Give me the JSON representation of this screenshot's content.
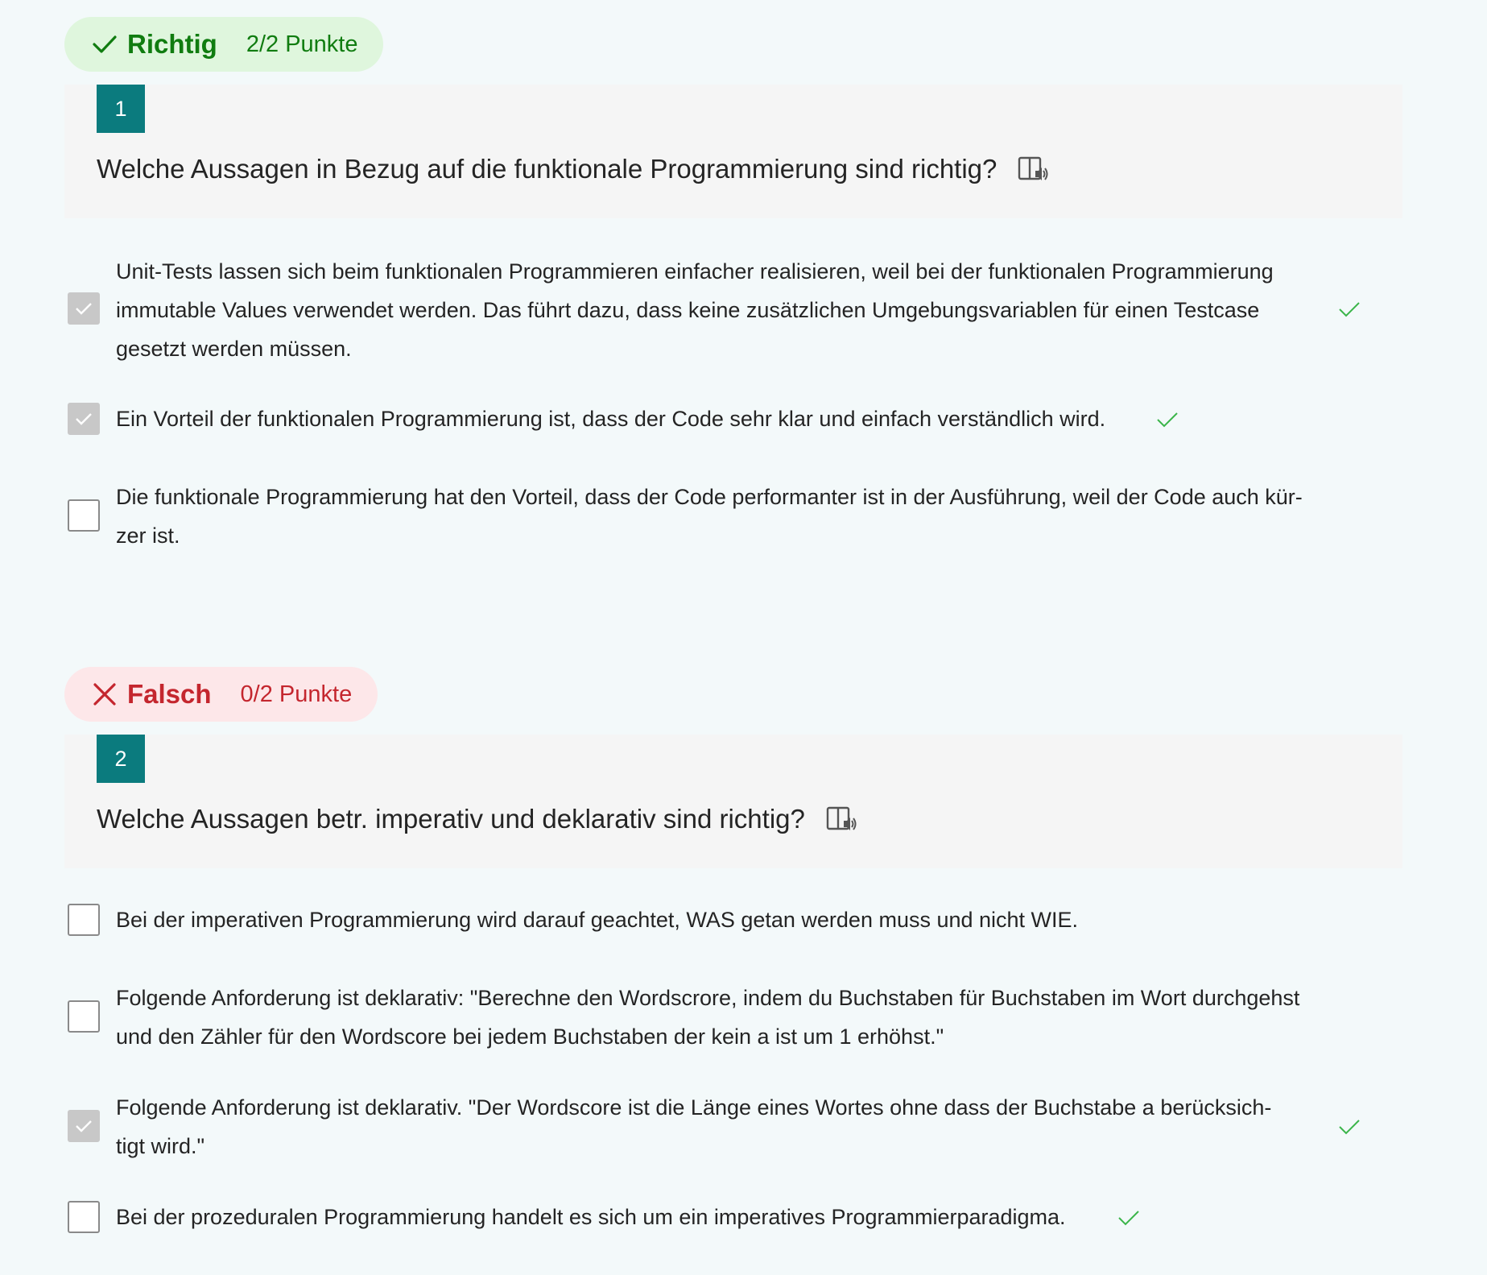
{
  "colors": {
    "correct_green": "#107c10",
    "wrong_red": "#c4262e",
    "question_number_bg": "#0b7b7e",
    "checkmark_green": "#3bb54a"
  },
  "questions": [
    {
      "result": {
        "status": "Richtig",
        "points": "2/2 Punkte",
        "icon": "checkmark-icon"
      },
      "number": "1",
      "title": "Welche Aussagen in Bezug auf die funktionale Programmierung sind richtig?",
      "reader_icon": "immersive-reader-icon",
      "options": [
        {
          "lines": [
            "Unit-Tests lassen sich beim funktionalen Programmieren einfacher realisieren, weil bei der funktionalen Programmierung",
            "immutable Values verwendet werden. Das führt dazu, dass keine zusätzlichen Umgebungsvariablen für einen Testcase",
            "gesetzt werden müssen."
          ],
          "checked": true,
          "correct_mark": true
        },
        {
          "lines": [
            "Ein Vorteil der funktionalen Programmierung ist, dass der Code sehr klar und einfach verständlich wird."
          ],
          "checked": true,
          "correct_mark": true
        },
        {
          "lines": [
            "Die funktionale Programmierung hat den Vorteil, dass der Code performanter ist in der Ausführung, weil der Code auch kür-",
            "zer ist."
          ],
          "checked": false,
          "correct_mark": false
        }
      ]
    },
    {
      "result": {
        "status": "Falsch",
        "points": "0/2 Punkte",
        "icon": "cross-icon"
      },
      "number": "2",
      "title": "Welche Aussagen betr. imperativ und deklarativ sind richtig?",
      "reader_icon": "immersive-reader-icon",
      "options": [
        {
          "lines": [
            "Bei der imperativen Programmierung wird darauf geachtet, WAS getan werden muss und nicht WIE."
          ],
          "checked": false,
          "correct_mark": false
        },
        {
          "lines": [
            "Folgende Anforderung ist deklarativ: \"Berechne den Wordscrore, indem du Buchstaben für Buchstaben im Wort durchgehst",
            "und den Zähler für den Wordscore bei jedem Buchstaben der kein a ist um 1 erhöhst.\""
          ],
          "checked": false,
          "correct_mark": false
        },
        {
          "lines": [
            "Folgende Anforderung ist deklarativ. \"Der Wordscore ist die Länge eines Wortes ohne dass der Buchstabe a berücksich-",
            "tigt wird.\""
          ],
          "checked": true,
          "correct_mark": true
        },
        {
          "lines": [
            "Bei der prozeduralen Programmierung handelt es sich um ein imperatives Programmierparadigma."
          ],
          "checked": false,
          "correct_mark": true
        }
      ]
    }
  ]
}
